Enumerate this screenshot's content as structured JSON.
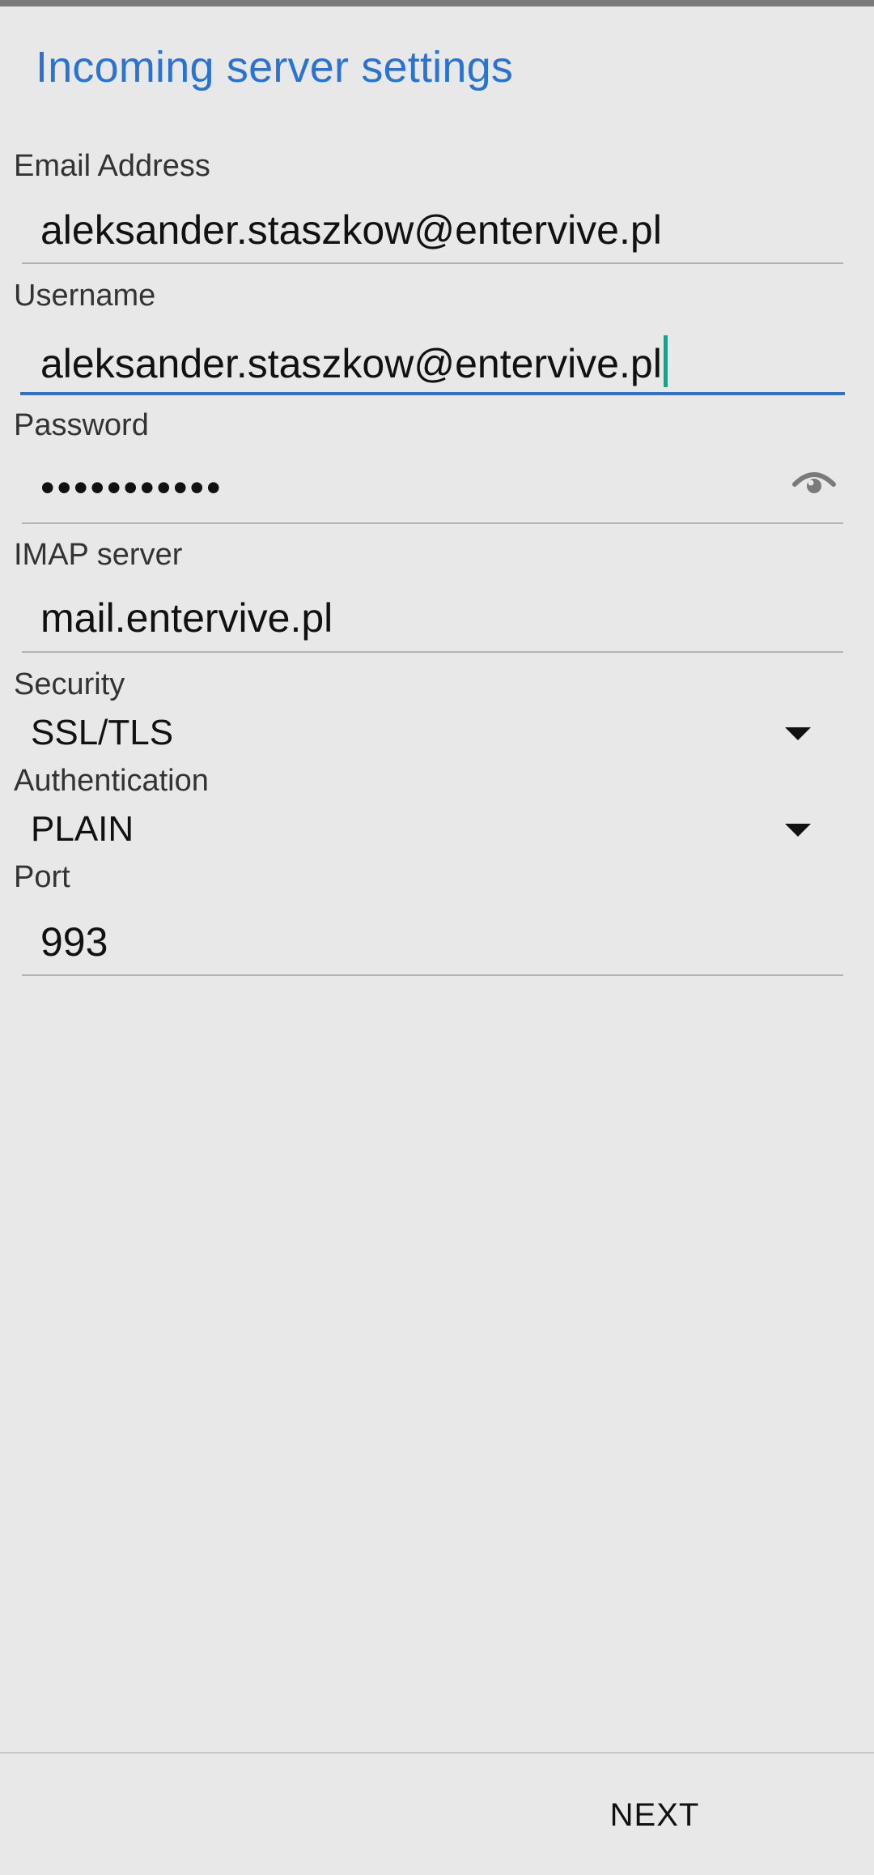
{
  "screen": {
    "title": "Incoming server settings"
  },
  "form": {
    "email": {
      "label": "Email Address",
      "value": "aleksander.staszkow@entervive.pl"
    },
    "username": {
      "label": "Username",
      "value": "aleksander.staszkow@entervive.pl"
    },
    "password": {
      "label": "Password",
      "masked_value": "•••••••••••"
    },
    "imap_server": {
      "label": "IMAP server",
      "value": "mail.entervive.pl"
    },
    "security": {
      "label": "Security",
      "selected": "SSL/TLS"
    },
    "authentication": {
      "label": "Authentication",
      "selected": "PLAIN"
    },
    "port": {
      "label": "Port",
      "value": "993"
    }
  },
  "footer": {
    "next_label": "NEXT"
  },
  "icons": {
    "password_toggle": "eye-icon",
    "dropdown": "triangle-down-icon"
  },
  "colors": {
    "accent": "#2a73d1",
    "caret": "#1f9e8a",
    "background": "#e8e8e8"
  }
}
